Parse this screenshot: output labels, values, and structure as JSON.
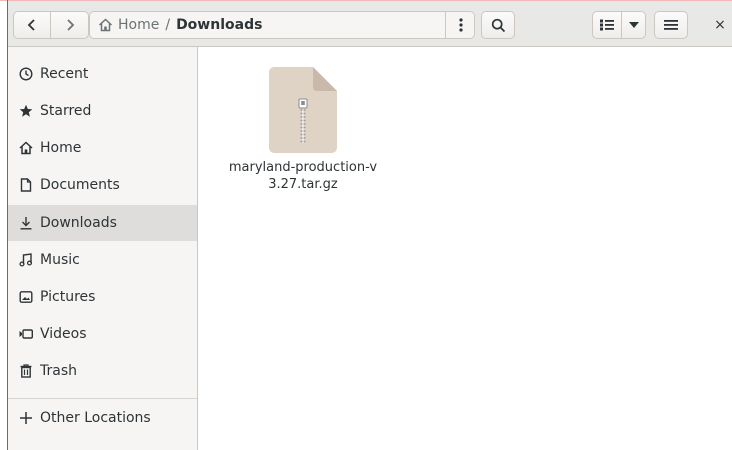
{
  "header": {
    "path": {
      "home_label": "Home",
      "separator": "/",
      "current": "Downloads"
    },
    "close_label": "×"
  },
  "sidebar": {
    "items": [
      {
        "label": "Recent",
        "icon": "clock-icon"
      },
      {
        "label": "Starred",
        "icon": "star-icon"
      },
      {
        "label": "Home",
        "icon": "home-icon"
      },
      {
        "label": "Documents",
        "icon": "document-icon"
      },
      {
        "label": "Downloads",
        "icon": "download-icon",
        "active": true
      },
      {
        "label": "Music",
        "icon": "music-icon"
      },
      {
        "label": "Pictures",
        "icon": "picture-icon"
      },
      {
        "label": "Videos",
        "icon": "video-icon"
      },
      {
        "label": "Trash",
        "icon": "trash-icon"
      }
    ],
    "other_locations": {
      "label": "Other Locations",
      "icon": "plus-icon"
    }
  },
  "files": [
    {
      "name": "maryland-production-v3.27.tar.gz",
      "icon": "archive-zip-icon"
    }
  ],
  "colors": {
    "accent_edge": "#e2393f",
    "sidebar_bg": "#f6f5f4",
    "header_bg": "#e8e8e7",
    "active_item_bg": "#dedddc",
    "archive_icon": "#dfd3c6"
  }
}
